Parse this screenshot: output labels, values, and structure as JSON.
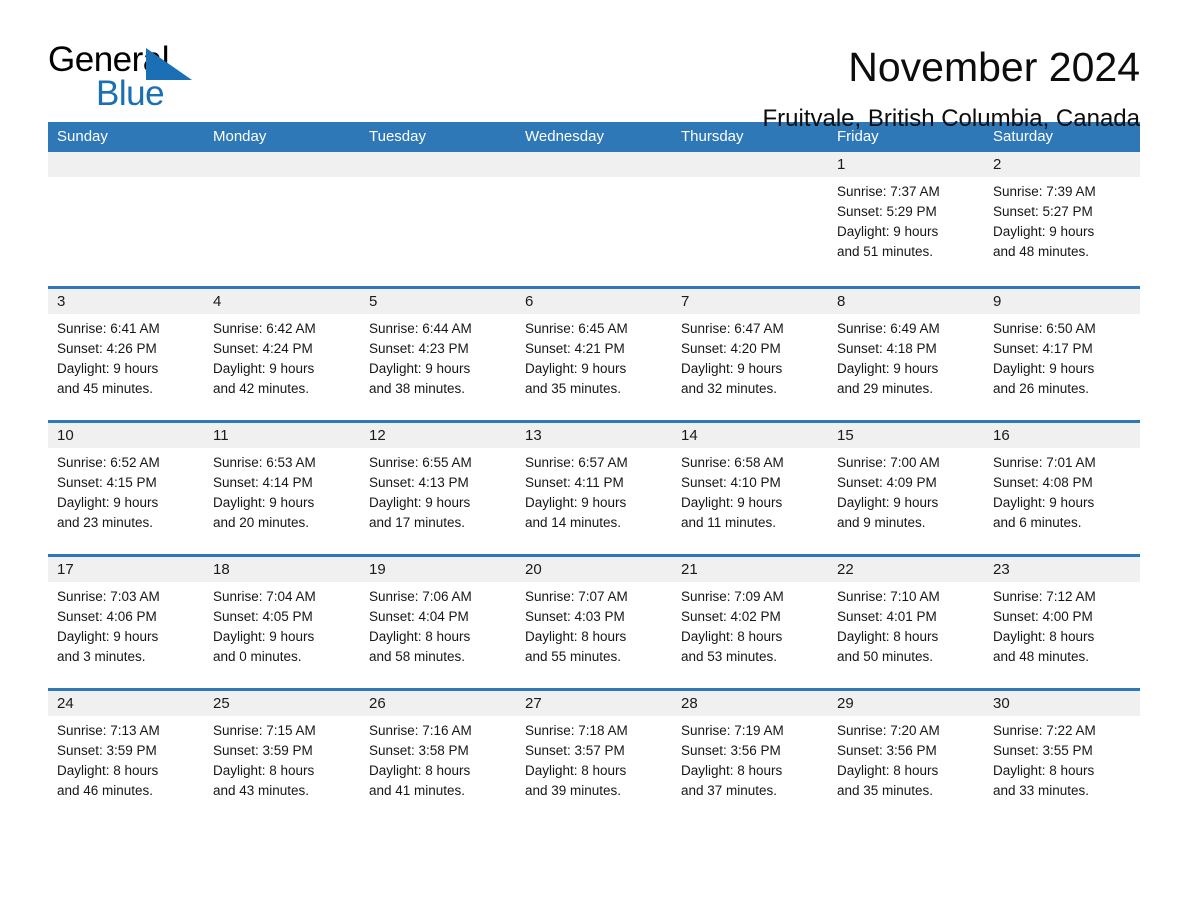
{
  "brand": {
    "logo_text_primary": "General",
    "logo_text_secondary": "Blue",
    "accent_color": "#2f78b8",
    "logo_triangle_color": "#1b6fb4"
  },
  "header": {
    "title": "November 2024",
    "subtitle": "Fruitvale, British Columbia, Canada"
  },
  "calendar": {
    "weekday_headers": [
      "Sunday",
      "Monday",
      "Tuesday",
      "Wednesday",
      "Thursday",
      "Friday",
      "Saturday"
    ],
    "weeks": [
      [
        {
          "day": "",
          "sunrise": "",
          "sunset": "",
          "daylight_line1": "",
          "daylight_line2": ""
        },
        {
          "day": "",
          "sunrise": "",
          "sunset": "",
          "daylight_line1": "",
          "daylight_line2": ""
        },
        {
          "day": "",
          "sunrise": "",
          "sunset": "",
          "daylight_line1": "",
          "daylight_line2": ""
        },
        {
          "day": "",
          "sunrise": "",
          "sunset": "",
          "daylight_line1": "",
          "daylight_line2": ""
        },
        {
          "day": "",
          "sunrise": "",
          "sunset": "",
          "daylight_line1": "",
          "daylight_line2": ""
        },
        {
          "day": "1",
          "sunrise": "Sunrise: 7:37 AM",
          "sunset": "Sunset: 5:29 PM",
          "daylight_line1": "Daylight: 9 hours",
          "daylight_line2": "and 51 minutes."
        },
        {
          "day": "2",
          "sunrise": "Sunrise: 7:39 AM",
          "sunset": "Sunset: 5:27 PM",
          "daylight_line1": "Daylight: 9 hours",
          "daylight_line2": "and 48 minutes."
        }
      ],
      [
        {
          "day": "3",
          "sunrise": "Sunrise: 6:41 AM",
          "sunset": "Sunset: 4:26 PM",
          "daylight_line1": "Daylight: 9 hours",
          "daylight_line2": "and 45 minutes."
        },
        {
          "day": "4",
          "sunrise": "Sunrise: 6:42 AM",
          "sunset": "Sunset: 4:24 PM",
          "daylight_line1": "Daylight: 9 hours",
          "daylight_line2": "and 42 minutes."
        },
        {
          "day": "5",
          "sunrise": "Sunrise: 6:44 AM",
          "sunset": "Sunset: 4:23 PM",
          "daylight_line1": "Daylight: 9 hours",
          "daylight_line2": "and 38 minutes."
        },
        {
          "day": "6",
          "sunrise": "Sunrise: 6:45 AM",
          "sunset": "Sunset: 4:21 PM",
          "daylight_line1": "Daylight: 9 hours",
          "daylight_line2": "and 35 minutes."
        },
        {
          "day": "7",
          "sunrise": "Sunrise: 6:47 AM",
          "sunset": "Sunset: 4:20 PM",
          "daylight_line1": "Daylight: 9 hours",
          "daylight_line2": "and 32 minutes."
        },
        {
          "day": "8",
          "sunrise": "Sunrise: 6:49 AM",
          "sunset": "Sunset: 4:18 PM",
          "daylight_line1": "Daylight: 9 hours",
          "daylight_line2": "and 29 minutes."
        },
        {
          "day": "9",
          "sunrise": "Sunrise: 6:50 AM",
          "sunset": "Sunset: 4:17 PM",
          "daylight_line1": "Daylight: 9 hours",
          "daylight_line2": "and 26 minutes."
        }
      ],
      [
        {
          "day": "10",
          "sunrise": "Sunrise: 6:52 AM",
          "sunset": "Sunset: 4:15 PM",
          "daylight_line1": "Daylight: 9 hours",
          "daylight_line2": "and 23 minutes."
        },
        {
          "day": "11",
          "sunrise": "Sunrise: 6:53 AM",
          "sunset": "Sunset: 4:14 PM",
          "daylight_line1": "Daylight: 9 hours",
          "daylight_line2": "and 20 minutes."
        },
        {
          "day": "12",
          "sunrise": "Sunrise: 6:55 AM",
          "sunset": "Sunset: 4:13 PM",
          "daylight_line1": "Daylight: 9 hours",
          "daylight_line2": "and 17 minutes."
        },
        {
          "day": "13",
          "sunrise": "Sunrise: 6:57 AM",
          "sunset": "Sunset: 4:11 PM",
          "daylight_line1": "Daylight: 9 hours",
          "daylight_line2": "and 14 minutes."
        },
        {
          "day": "14",
          "sunrise": "Sunrise: 6:58 AM",
          "sunset": "Sunset: 4:10 PM",
          "daylight_line1": "Daylight: 9 hours",
          "daylight_line2": "and 11 minutes."
        },
        {
          "day": "15",
          "sunrise": "Sunrise: 7:00 AM",
          "sunset": "Sunset: 4:09 PM",
          "daylight_line1": "Daylight: 9 hours",
          "daylight_line2": "and 9 minutes."
        },
        {
          "day": "16",
          "sunrise": "Sunrise: 7:01 AM",
          "sunset": "Sunset: 4:08 PM",
          "daylight_line1": "Daylight: 9 hours",
          "daylight_line2": "and 6 minutes."
        }
      ],
      [
        {
          "day": "17",
          "sunrise": "Sunrise: 7:03 AM",
          "sunset": "Sunset: 4:06 PM",
          "daylight_line1": "Daylight: 9 hours",
          "daylight_line2": "and 3 minutes."
        },
        {
          "day": "18",
          "sunrise": "Sunrise: 7:04 AM",
          "sunset": "Sunset: 4:05 PM",
          "daylight_line1": "Daylight: 9 hours",
          "daylight_line2": "and 0 minutes."
        },
        {
          "day": "19",
          "sunrise": "Sunrise: 7:06 AM",
          "sunset": "Sunset: 4:04 PM",
          "daylight_line1": "Daylight: 8 hours",
          "daylight_line2": "and 58 minutes."
        },
        {
          "day": "20",
          "sunrise": "Sunrise: 7:07 AM",
          "sunset": "Sunset: 4:03 PM",
          "daylight_line1": "Daylight: 8 hours",
          "daylight_line2": "and 55 minutes."
        },
        {
          "day": "21",
          "sunrise": "Sunrise: 7:09 AM",
          "sunset": "Sunset: 4:02 PM",
          "daylight_line1": "Daylight: 8 hours",
          "daylight_line2": "and 53 minutes."
        },
        {
          "day": "22",
          "sunrise": "Sunrise: 7:10 AM",
          "sunset": "Sunset: 4:01 PM",
          "daylight_line1": "Daylight: 8 hours",
          "daylight_line2": "and 50 minutes."
        },
        {
          "day": "23",
          "sunrise": "Sunrise: 7:12 AM",
          "sunset": "Sunset: 4:00 PM",
          "daylight_line1": "Daylight: 8 hours",
          "daylight_line2": "and 48 minutes."
        }
      ],
      [
        {
          "day": "24",
          "sunrise": "Sunrise: 7:13 AM",
          "sunset": "Sunset: 3:59 PM",
          "daylight_line1": "Daylight: 8 hours",
          "daylight_line2": "and 46 minutes."
        },
        {
          "day": "25",
          "sunrise": "Sunrise: 7:15 AM",
          "sunset": "Sunset: 3:59 PM",
          "daylight_line1": "Daylight: 8 hours",
          "daylight_line2": "and 43 minutes."
        },
        {
          "day": "26",
          "sunrise": "Sunrise: 7:16 AM",
          "sunset": "Sunset: 3:58 PM",
          "daylight_line1": "Daylight: 8 hours",
          "daylight_line2": "and 41 minutes."
        },
        {
          "day": "27",
          "sunrise": "Sunrise: 7:18 AM",
          "sunset": "Sunset: 3:57 PM",
          "daylight_line1": "Daylight: 8 hours",
          "daylight_line2": "and 39 minutes."
        },
        {
          "day": "28",
          "sunrise": "Sunrise: 7:19 AM",
          "sunset": "Sunset: 3:56 PM",
          "daylight_line1": "Daylight: 8 hours",
          "daylight_line2": "and 37 minutes."
        },
        {
          "day": "29",
          "sunrise": "Sunrise: 7:20 AM",
          "sunset": "Sunset: 3:56 PM",
          "daylight_line1": "Daylight: 8 hours",
          "daylight_line2": "and 35 minutes."
        },
        {
          "day": "30",
          "sunrise": "Sunrise: 7:22 AM",
          "sunset": "Sunset: 3:55 PM",
          "daylight_line1": "Daylight: 8 hours",
          "daylight_line2": "and 33 minutes."
        }
      ]
    ]
  }
}
